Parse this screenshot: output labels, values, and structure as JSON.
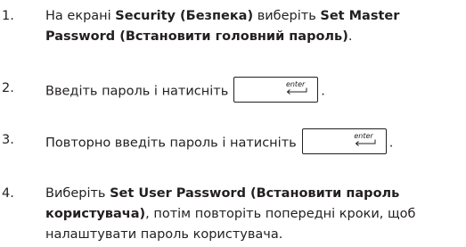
{
  "steps": [
    {
      "number": "1.",
      "line1_prefix": "На екрані ",
      "line1_bold": "Security (Безпека)",
      "line1_mid": " виберіть ",
      "line1_bold2": "Set Master",
      "line2_bold": "Password (Встановити головний пароль)",
      "line2_suffix": "."
    },
    {
      "number": "2.",
      "text": "Введіть пароль і натисніть",
      "key_label": "enter",
      "suffix": "."
    },
    {
      "number": "3.",
      "text": "Повторно введіть пароль і натисніть",
      "key_label": "enter",
      "suffix": "."
    },
    {
      "number": "4.",
      "line1_prefix": "Виберіть ",
      "line1_bold": "Set User Password (Встановити пароль",
      "line2_bold": "користувача)",
      "line2_suffix": ", потім повторіть попередні кроки, щоб",
      "line3": "налаштувати пароль користувача."
    }
  ]
}
